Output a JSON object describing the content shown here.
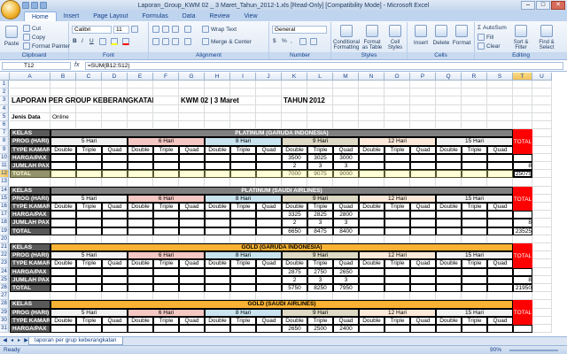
{
  "window": {
    "title": "Laporan_Group_KWM 02 _ 3 Maret_Tahun_2012-1.xls  [Read-Only]  [Compatibility Mode] - Microsoft Excel",
    "minimize": "–",
    "maximize": "□",
    "close": "✕"
  },
  "ribbon_tabs": [
    "Home",
    "Insert",
    "Page Layout",
    "Formulas",
    "Data",
    "Review",
    "View"
  ],
  "ribbon": {
    "clipboard": {
      "label": "Clipboard",
      "paste": "Paste",
      "cut": "Cut",
      "copy": "Copy",
      "format_painter": "Format Painter"
    },
    "font": {
      "label": "Font",
      "font_name": "Calibri",
      "font_size": "11",
      "bold": "B",
      "italic": "I",
      "underline": "U"
    },
    "alignment": {
      "label": "Alignment",
      "wrap_text": "Wrap Text",
      "merge_center": "Merge & Center"
    },
    "number": {
      "label": "Number",
      "format": "General",
      "currency": "$",
      "percent": "%",
      "comma": ","
    },
    "styles": {
      "label": "Styles",
      "conditional": "Conditional Formatting",
      "format_table": "Format as Table",
      "cell_styles": "Cell Styles"
    },
    "cells": {
      "label": "Cells",
      "insert": "Insert",
      "delete": "Delete",
      "format": "Format"
    },
    "editing": {
      "label": "Editing",
      "autosum": "AutoSum",
      "fill": "Fill",
      "clear": "Clear",
      "sort_filter": "Sort & Filter",
      "find_select": "Find & Select"
    }
  },
  "formula_bar": {
    "name_box": "T12",
    "fx": "fx",
    "formula": "=SUM(B12:S12)"
  },
  "columns": [
    "A",
    "B",
    "C",
    "D",
    "E",
    "F",
    "G",
    "H",
    "I",
    "J",
    "K",
    "L",
    "M",
    "N",
    "O",
    "P",
    "Q",
    "R",
    "S",
    "T",
    "U"
  ],
  "sheet": {
    "report_title": "LAPORAN PER GROUP KEBERANGKATAN",
    "kwm": "KWM 02 | 3 Maret",
    "tahun_label": "TAHUN",
    "tahun_value": "2012",
    "jenis_data_label": "Jenis Data",
    "jenis_data_value": "Online",
    "labels": {
      "kelas": "KELAS",
      "prog": "PROG (HARI)",
      "type": "TYPE KAMAR",
      "harga": "HARGA/PAX",
      "jumlah": "JUMLAH PAX",
      "total": "TOTAL",
      "grand": "GRAND",
      "grand_total": "TOTAL"
    },
    "prog_days": [
      "5 Hari",
      "6 Hari",
      "8 Hari",
      "9 Hari",
      "12 Hari",
      "15 Hari"
    ],
    "room_types": [
      "Double",
      "Triple",
      "Quad"
    ],
    "sections": [
      {
        "kelas": "PLATINUM (GARUDA INDONESIA)",
        "harga": [
          "3500",
          "3025",
          "3000"
        ],
        "jumlah": [
          "2",
          "3",
          "3"
        ],
        "total": [
          "7000",
          "9075",
          "9000"
        ],
        "grand_jumlah": "8",
        "grand_total": "25075"
      },
      {
        "kelas": "PLATINUM (SAUDI AIRLINES)",
        "harga": [
          "3325",
          "2825",
          "2800"
        ],
        "jumlah": [
          "2",
          "3",
          "3"
        ],
        "total": [
          "6650",
          "8475",
          "8400"
        ],
        "grand_jumlah": "8",
        "grand_total": "23525"
      },
      {
        "kelas": "GOLD (GARUDA INDONESIA)",
        "harga": [
          "2875",
          "2750",
          "2650"
        ],
        "jumlah": [
          "2",
          "3",
          "3"
        ],
        "total": [
          "5750",
          "8250",
          "7950"
        ],
        "grand_jumlah": "8",
        "grand_total": "21950"
      },
      {
        "kelas": "GOLD (SAUDI AIRLINES)",
        "harga": [
          "2650",
          "2500",
          "2400"
        ],
        "jumlah": [],
        "total": [],
        "grand_jumlah": "",
        "grand_total": ""
      }
    ]
  },
  "sheet_tab": "laporan per grup keberangkatan",
  "status": {
    "ready": "Ready",
    "zoom": "90%"
  },
  "colors": {
    "dark_header": "#595959",
    "platinum_band": "#808080",
    "gold_band": "#f9b233",
    "day_colors": [
      "#f2f2f2",
      "#f4c7c3",
      "#c9e3ee",
      "#ddd9c4",
      "#fde9d9",
      "#f2f2f2"
    ],
    "grand": "#ff0000"
  }
}
